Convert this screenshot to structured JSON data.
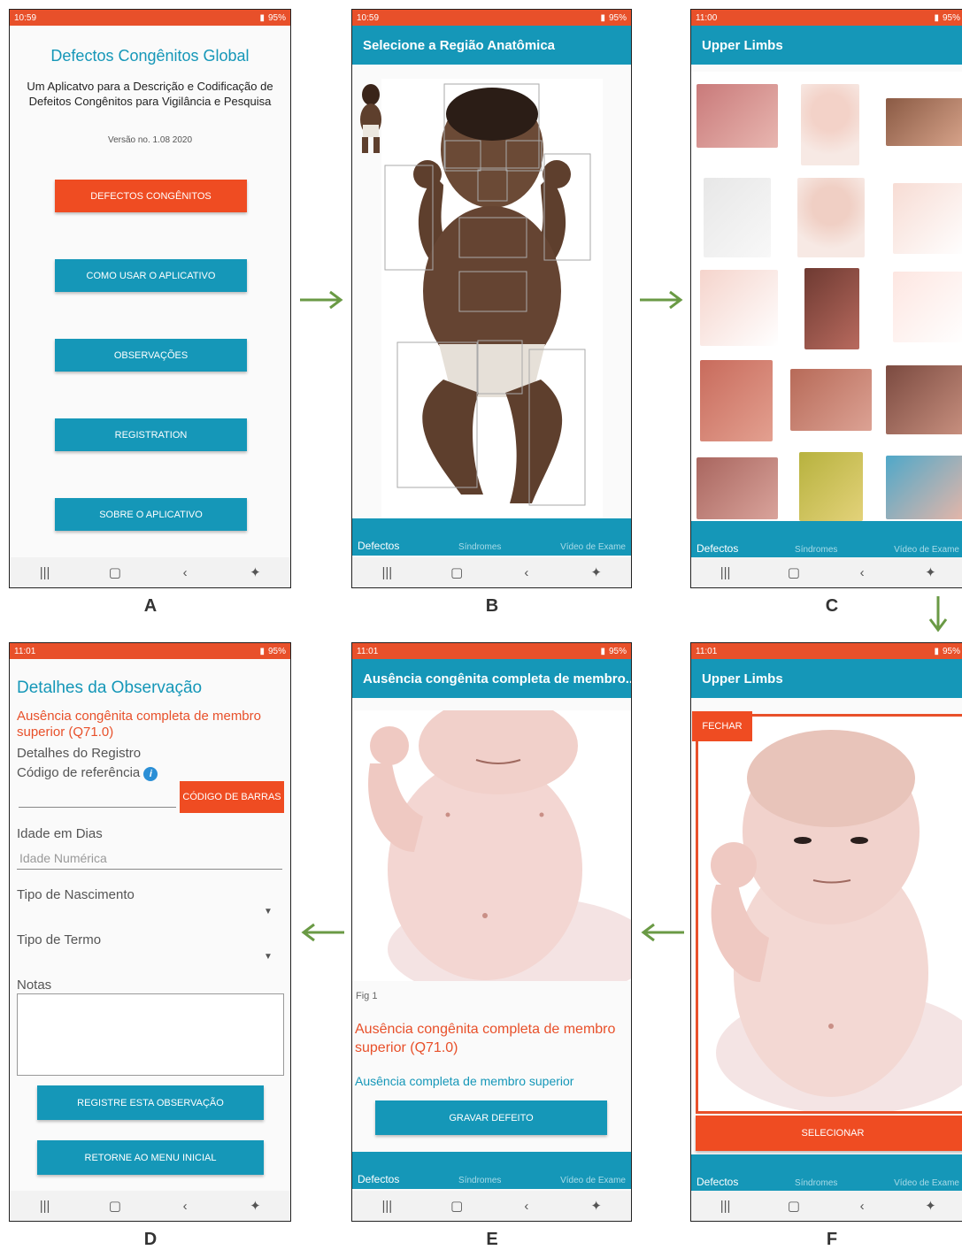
{
  "colors": {
    "status_bar": "#e8502a",
    "app_bar": "#1597b8",
    "button_teal": "#1597b8",
    "button_orange": "#ef4c22",
    "title_text": "#1597b8",
    "arrow": "#6a9a45"
  },
  "panel_labels": {
    "a": "A",
    "b": "B",
    "c": "C",
    "d": "D",
    "e": "E",
    "f": "F"
  },
  "screen_a": {
    "status_time": "10:59",
    "status_right": "95%",
    "title": "Defectos Congênitos Global",
    "subtitle": "Um Aplicatvo para a Descrição e Codificação de Defeitos Congênitos para Vigilância e Pesquisa",
    "version": "Versão no. 1.08 2020",
    "buttons": [
      "DEFECTOS CONGÊNITOS",
      "COMO USAR O APLICATIVO",
      "OBSERVAÇÕES",
      "REGISTRATION",
      "SOBRE O APLICATIVO"
    ]
  },
  "screen_b": {
    "status_time": "10:59",
    "status_right": "95%",
    "app_title": "Selecione a Região Anatômica",
    "tabs": [
      "Defectos",
      "Síndromes",
      "Vídeo de Exame"
    ]
  },
  "screen_c": {
    "status_time": "11:00",
    "status_right": "95%",
    "app_title": "Upper Limbs",
    "tabs": [
      "Defectos",
      "Síndromes",
      "Vídeo de Exame"
    ]
  },
  "screen_d": {
    "status_time": "11:01",
    "status_right": "95%",
    "title": "Detalhes da Observação",
    "defect": "Ausência congênita completa de membro superior (Q71.0)",
    "registro_label": "Detalhes do Registro",
    "ref_label": "Código de referência",
    "barcode_button": "CÓDIGO DE BARRAS",
    "idade_label": "Idade em Dias",
    "idade_placeholder": "Idade Numérica",
    "nascimento_label": "Tipo de Nascimento",
    "termo_label": "Tipo de Termo",
    "notas_label": "Notas",
    "register_button": "REGISTRE ESTA OBSERVAÇÃO",
    "return_button": "RETORNE AO MENU INICIAL"
  },
  "screen_e": {
    "status_time": "11:01",
    "status_right": "95%",
    "app_title": "Ausência congênita completa de membro...",
    "fig_caption": "Fig 1",
    "defect_title": "Ausência congênita completa de membro superior (Q71.0)",
    "defect_subtitle": "Ausência completa de membro superior",
    "record_button": "GRAVAR DEFEITO",
    "tabs": [
      "Defectos",
      "Síndromes",
      "Vídeo de Exame"
    ]
  },
  "screen_f": {
    "status_time": "11:01",
    "status_right": "95%",
    "app_title": "Upper Limbs",
    "close_button": "FECHAR",
    "select_button": "SELECIONAR",
    "tabs": [
      "Defectos",
      "Síndromes",
      "Vídeo de Exame"
    ]
  }
}
